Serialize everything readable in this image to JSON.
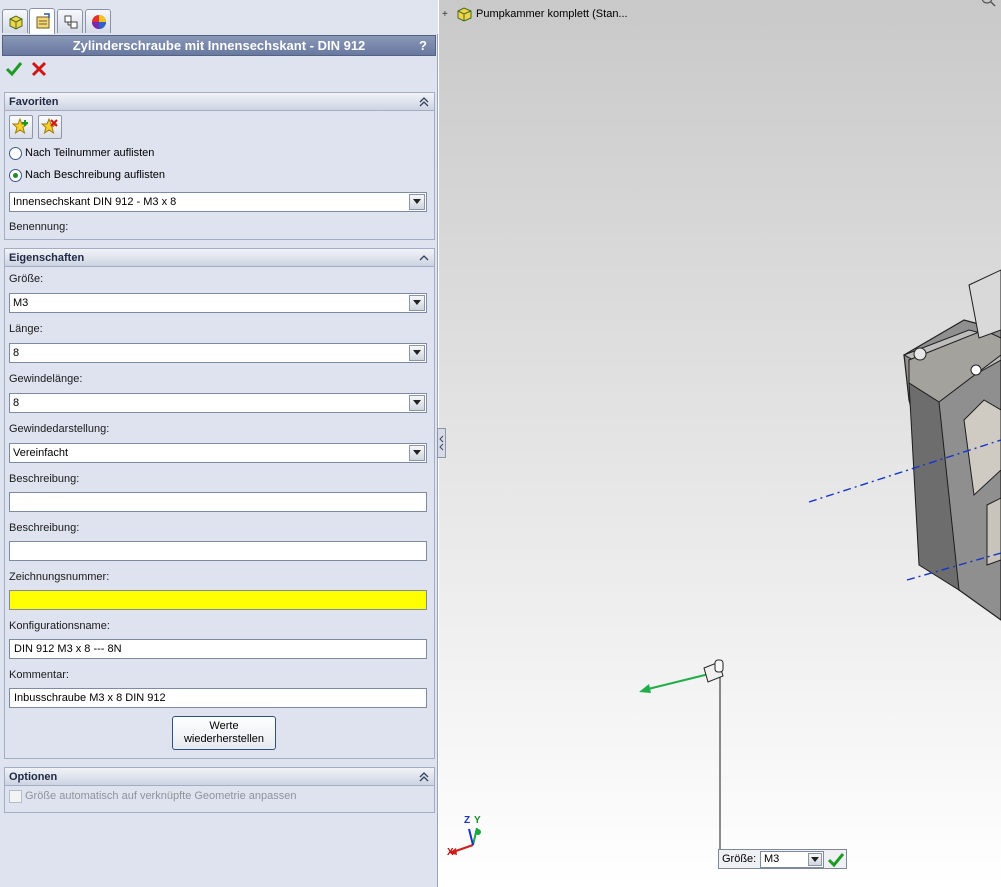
{
  "panel": {
    "title": "Zylinderschraube mit Innensechskant - DIN 912",
    "help": "?",
    "tabs": [
      "feature-manager",
      "property-manager",
      "configuration-manager",
      "display-manager"
    ]
  },
  "favorites": {
    "header": "Favoriten",
    "radio_part_number": "Nach Teilnummer auflisten",
    "radio_description": "Nach Beschreibung auflisten",
    "selected_favorite": "Innensechskant DIN 912 - M3 x 8",
    "name_label": "Benennung:"
  },
  "properties": {
    "header": "Eigenschaften",
    "size_label": "Größe:",
    "size_value": "M3",
    "length_label": "Länge:",
    "length_value": "8",
    "thread_length_label": "Gewindelänge:",
    "thread_length_value": "8",
    "thread_display_label": "Gewindedarstellung:",
    "thread_display_value": "Vereinfacht",
    "description1_label": "Beschreibung:",
    "description1_value": "",
    "description2_label": "Beschreibung:",
    "description2_value": "",
    "drawing_number_label": "Zeichnungsnummer:",
    "drawing_number_value": "",
    "config_name_label": "Konfigurationsname:",
    "config_name_value": "DIN 912 M3 x 8 --- 8N",
    "comment_label": "Kommentar:",
    "comment_value": "Inbusschraube M3 x 8 DIN 912",
    "restore_line1": "Werte",
    "restore_line2": "wiederherstellen"
  },
  "options": {
    "header": "Optionen",
    "auto_size": "Größe automatisch auf verknüpfte Geometrie anpassen"
  },
  "viewport": {
    "tree_expand": "+",
    "tree_label": "Pumpkammer komplett  (Stan...",
    "popup_size_label": "Größe:",
    "popup_size_value": "M3",
    "axis_x": "X",
    "axis_y": "Y",
    "axis_z": "Z"
  },
  "colors": {
    "title_bar": "#6f7fa5",
    "panel_bg": "#dee3ef",
    "highlight_field": "#ffff00",
    "ok_green": "#1d9b24",
    "cancel_red": "#d11414"
  }
}
